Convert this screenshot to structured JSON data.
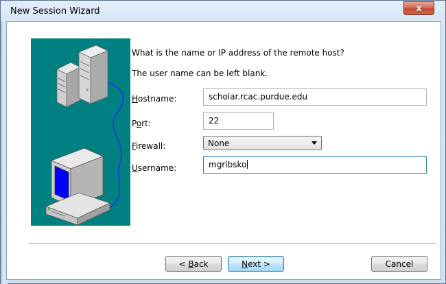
{
  "window": {
    "title": "New Session Wizard",
    "close_glyph": "x"
  },
  "wizard": {
    "question": "What is the name or IP address of the remote host?",
    "note": "The user name can be left blank.",
    "fields": {
      "hostname": {
        "label_mnemonic": "H",
        "label_rest": "ostname:",
        "value": "scholar.rcac.purdue.edu"
      },
      "port": {
        "label_first": "P",
        "label_mnemonic": "o",
        "label_rest": "rt:",
        "value": "22"
      },
      "firewall": {
        "label_mnemonic": "F",
        "label_rest": "irewall:",
        "value": "None"
      },
      "username": {
        "label_mnemonic": "U",
        "label_rest": "sername:",
        "value": "mgribsko"
      }
    }
  },
  "buttons": {
    "back": {
      "prefix": "< ",
      "mnemonic": "B",
      "rest": "ack"
    },
    "next": {
      "mnemonic": "N",
      "rest": "ext >"
    },
    "cancel": "Cancel"
  },
  "illustration": {
    "icons": [
      "server-tower-icon",
      "server-tower-icon",
      "network-cable-icon",
      "desktop-computer-icon"
    ],
    "colors": {
      "background": "#008080",
      "cable": "#1f3fd6",
      "screen": "#0000ff"
    }
  }
}
